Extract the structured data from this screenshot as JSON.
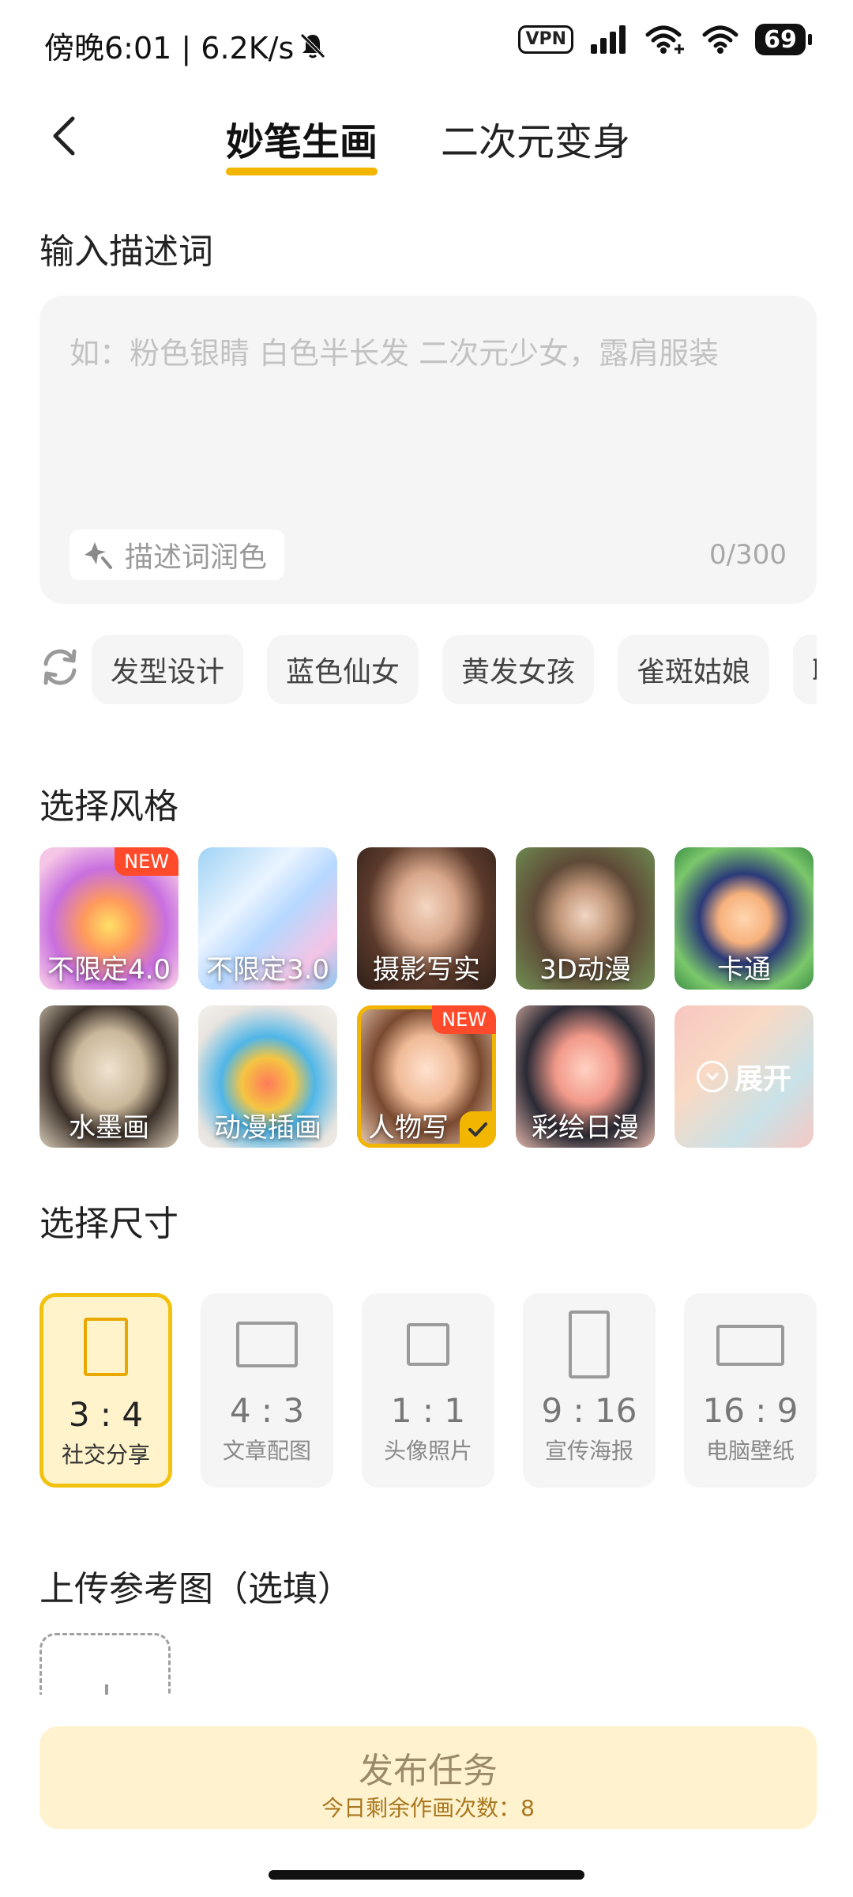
{
  "status_bar": {
    "text": "傍晚6:01 | 6.2K/s",
    "vpn": "VPN",
    "battery": "69"
  },
  "header": {
    "tabs": [
      {
        "label": "妙笔生画",
        "active": true
      },
      {
        "label": "二次元变身",
        "active": false
      }
    ]
  },
  "prompt": {
    "title": "输入描述词",
    "placeholder": "如：粉色银睛 白色半长发 二次元少女，露肩服装",
    "polish_label": "描述词润色",
    "counter": "0/300"
  },
  "suggestions": [
    "发型设计",
    "蓝色仙女",
    "黄发女孩",
    "雀斑姑娘",
    "职"
  ],
  "styles": {
    "title": "选择风格",
    "items": [
      {
        "label": "不限定4.0",
        "badge": "NEW"
      },
      {
        "label": "不限定3.0",
        "badge": ""
      },
      {
        "label": "摄影写实",
        "badge": ""
      },
      {
        "label": "3D动漫",
        "badge": ""
      },
      {
        "label": "卡通",
        "badge": ""
      },
      {
        "label": "水墨画",
        "badge": ""
      },
      {
        "label": "动漫插画",
        "badge": ""
      },
      {
        "label": "人物写",
        "badge": "NEW",
        "selected": true
      },
      {
        "label": "彩绘日漫",
        "badge": ""
      }
    ],
    "expand_label": "展开"
  },
  "sizes": {
    "title": "选择尺寸",
    "items": [
      {
        "ratio": "3 : 4",
        "desc": "社交分享",
        "active": true
      },
      {
        "ratio": "4 : 3",
        "desc": "文章配图"
      },
      {
        "ratio": "1 : 1",
        "desc": "头像照片"
      },
      {
        "ratio": "9 : 16",
        "desc": "宣传海报"
      },
      {
        "ratio": "16 : 9",
        "desc": "电脑壁纸"
      }
    ]
  },
  "upload": {
    "title": "上传参考图（选填）"
  },
  "publish": {
    "label": "发布任务",
    "remaining": "今日剩余作画次数：8"
  },
  "colors": {
    "accent": "#f2b600",
    "new_badge": "#ff4b2b",
    "publish_bg": "#fff3cf"
  }
}
